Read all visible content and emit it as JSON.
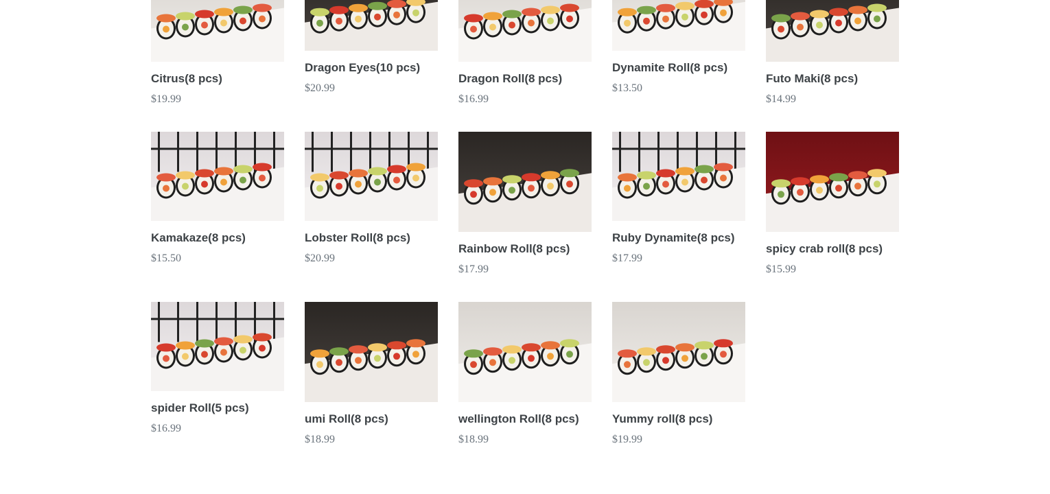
{
  "products": [
    {
      "name": "Citrus(8 pcs)",
      "price": "$19.99",
      "image": "sushi-roll-salmon-citrus",
      "scene": "table"
    },
    {
      "name": "Dragon Eyes(10 pcs)",
      "price": "$20.99",
      "image": "sushi-roll-tempura-sauce",
      "scene": "dark"
    },
    {
      "name": "Dragon Roll(8 pcs)",
      "price": "$16.99",
      "image": "sushi-roll-avocado-topped",
      "scene": "table"
    },
    {
      "name": "Dynamite Roll(8 pcs)",
      "price": "$13.50",
      "image": "sushi-roll-tobiko-lemon",
      "scene": "table"
    },
    {
      "name": "Futo Maki(8 pcs)",
      "price": "$14.99",
      "image": "sushi-roll-futo-maki",
      "scene": "dark"
    },
    {
      "name": "Kamakaze(8 pcs)",
      "price": "$15.50",
      "image": "sushi-roll-nori-lemon",
      "scene": "screen"
    },
    {
      "name": "Lobster Roll(8 pcs)",
      "price": "$20.99",
      "image": "sushi-roll-lobster",
      "scene": "screen"
    },
    {
      "name": "Rainbow Roll(8 pcs)",
      "price": "$17.99",
      "image": "sushi-roll-rainbow",
      "scene": "dark"
    },
    {
      "name": "Ruby Dynamite(8 pcs)",
      "price": "$17.99",
      "image": "sushi-roll-salmon-mayo",
      "scene": "screen"
    },
    {
      "name": "spicy crab roll(8 pcs)",
      "price": "$15.99",
      "image": "sushi-roll-spicy-crab",
      "scene": "red"
    },
    {
      "name": "spider Roll(5 pcs)",
      "price": "$16.99",
      "image": "sushi-roll-spider",
      "scene": "screen"
    },
    {
      "name": "umi Roll(8 pcs)",
      "price": "$18.99",
      "image": "sushi-roll-tuna-topped",
      "scene": "dark"
    },
    {
      "name": "wellington Roll(8 pcs)",
      "price": "$18.99",
      "image": "sushi-roll-avocado-wrapped",
      "scene": "table"
    },
    {
      "name": "Yummy roll(8 pcs)",
      "price": "$19.99",
      "image": "sushi-roll-yummy",
      "scene": "table"
    }
  ],
  "colors": {
    "title": "#3d4246",
    "price": "#69727b",
    "background": "#ffffff"
  }
}
